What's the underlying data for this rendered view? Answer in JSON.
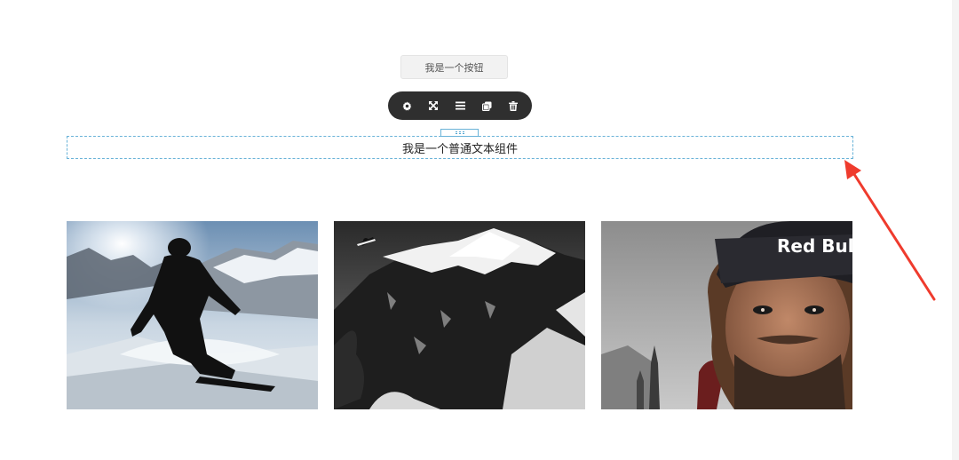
{
  "canvas": {
    "button_label": "我是一个按钮",
    "text_component": "我是一个普通文本组件"
  },
  "toolbar": {
    "items": [
      {
        "name": "settings",
        "icon": "gear-icon"
      },
      {
        "name": "move",
        "icon": "move-arrows-icon"
      },
      {
        "name": "menu",
        "icon": "list-icon"
      },
      {
        "name": "copy",
        "icon": "copy-icon"
      },
      {
        "name": "delete",
        "icon": "trash-icon"
      }
    ]
  },
  "gallery": {
    "images": [
      {
        "subject": "snowboarder silhouette"
      },
      {
        "subject": "snowy mountain peak"
      },
      {
        "subject": "man in beanie"
      }
    ],
    "brand_text": "Red Bull"
  },
  "annotation": {
    "arrow_color": "#ef3b2d"
  },
  "colors": {
    "selection_outline": "#6ab3d8",
    "toolbar_bg": "#2f2f2f"
  }
}
